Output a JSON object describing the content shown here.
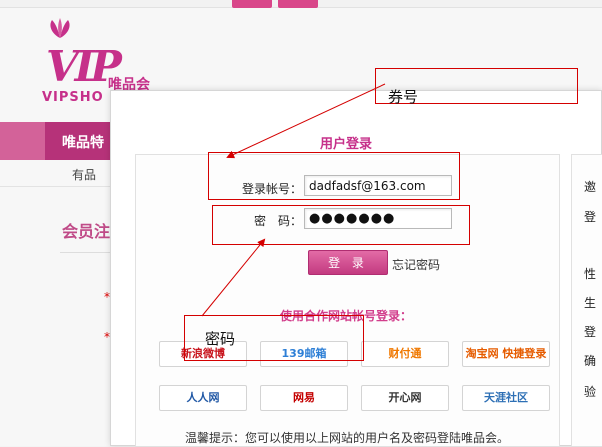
{
  "header": {
    "brand_cn": "唯品会",
    "brand_en": "VIPSHO",
    "logo_text": "VIP"
  },
  "nav": {
    "main_item": "唯品特",
    "sub_item": "有品"
  },
  "page": {
    "member_title": "会员注",
    "required_mark": "*"
  },
  "modal": {
    "title": "用户登录",
    "account_label": "登录帐号：",
    "account_value": "dadfadsf@163.com",
    "password_label": "密　码：",
    "password_mask": "●●●●●●●",
    "login_button": "登 录",
    "forgot_link": "忘记密码",
    "partner_title": "使用合作网站帐号登录：",
    "partners": [
      {
        "name": "新浪微博",
        "color": "#c8141d"
      },
      {
        "name": "139邮箱",
        "color": "#2d7fd6"
      },
      {
        "name": "财付通",
        "color": "#f07800"
      },
      {
        "name": "淘宝网 快捷登录",
        "color": "#e65c00"
      },
      {
        "name": "人人网",
        "color": "#2259a6"
      },
      {
        "name": "网易",
        "color": "#c40000"
      },
      {
        "name": "开心网",
        "color": "#333333"
      },
      {
        "name": "天涯社区",
        "color": "#2d6fb5"
      }
    ],
    "tip": "温馨提示：您可以使用以上网站的用户名及密码登陆唯品会。",
    "right_labels": [
      "邀",
      "登",
      "性",
      "生",
      "登",
      "确",
      "验"
    ]
  },
  "annotations": {
    "voucher_label": "券号",
    "password_label": "密码"
  },
  "colors": {
    "brand": "#c6308a",
    "nav": "#b63279",
    "annotation": "#d40000"
  }
}
